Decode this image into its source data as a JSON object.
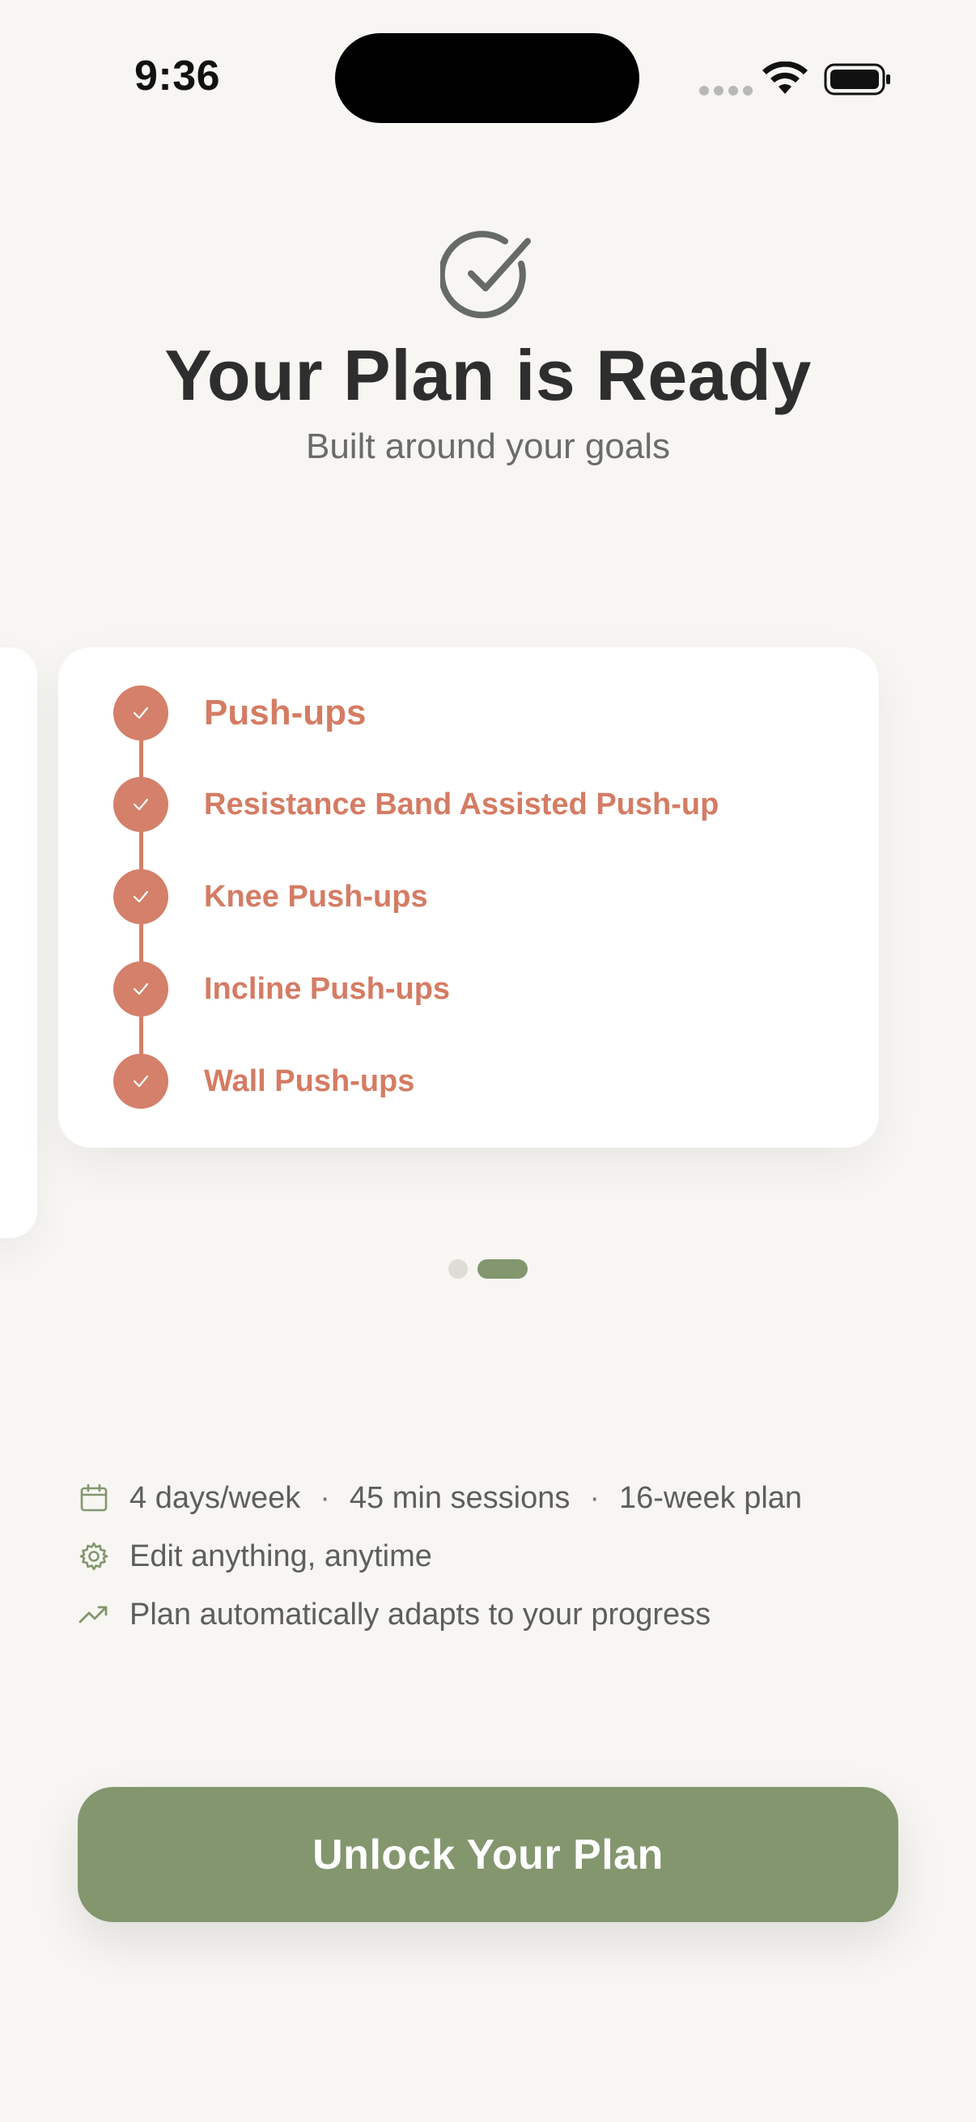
{
  "status_bar": {
    "time": "9:36"
  },
  "header": {
    "title": "Your Plan is Ready",
    "subtitle": "Built around your goals",
    "icon": "check-circle-icon"
  },
  "carousel": {
    "card": {
      "exercises": [
        {
          "label": "Push-ups",
          "completed": true
        },
        {
          "label": "Resistance Band Assisted Push-up",
          "completed": true
        },
        {
          "label": "Knee Push-ups",
          "completed": true
        },
        {
          "label": "Incline Push-ups",
          "completed": true
        },
        {
          "label": "Wall Push-ups",
          "completed": true
        }
      ]
    },
    "pagination": {
      "count": 2,
      "active_index": 1
    }
  },
  "features": {
    "schedule": {
      "days": "4 days/week",
      "duration": "45 min sessions",
      "length": "16-week plan",
      "separator": "·",
      "icon": "calendar-icon"
    },
    "edit": {
      "text": "Edit anything, anytime",
      "icon": "gear-icon"
    },
    "adapt": {
      "text": "Plan automatically adapts to your progress",
      "icon": "trending-up-icon"
    }
  },
  "cta": {
    "label": "Unlock Your Plan"
  },
  "colors": {
    "background": "#f7f6f3",
    "accent_green": "#83966e",
    "exercise_coral": "#d47c64",
    "title": "#2e2e2e",
    "text_muted": "#5e5e5e"
  }
}
